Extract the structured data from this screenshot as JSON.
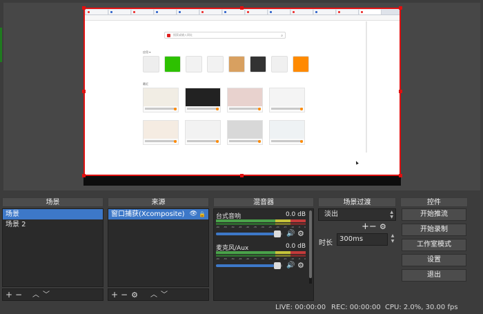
{
  "preview": {
    "browser": {
      "tab_labels": [
        "",
        "",
        "",
        "",
        "",
        "",
        "",
        "",
        "",
        "",
        "",
        "",
        ""
      ],
      "search_placeholder": "搜索或输入网址",
      "apps_section_label": "应用 ▾",
      "recent_section_label": "最近",
      "app_tiles": [
        {
          "caption": "",
          "color": "#eeeeee"
        },
        {
          "caption": "",
          "color": "#2dc100"
        },
        {
          "caption": "",
          "color": "#f2f2f2"
        },
        {
          "caption": "",
          "color": "#f2f2f2"
        },
        {
          "caption": "",
          "color": "#d8a060"
        },
        {
          "caption": "",
          "color": "#333333"
        },
        {
          "caption": "",
          "color": "#f0f0f0"
        },
        {
          "caption": "",
          "color": "#ff8a00"
        }
      ]
    }
  },
  "scenes": {
    "title": "场景",
    "items": [
      "场景",
      "场景 2"
    ],
    "selected": 0
  },
  "sources": {
    "title": "来源",
    "items": [
      "窗口捕获(Xcomposite)"
    ],
    "selected": 0
  },
  "mixer": {
    "title": "混音器",
    "tracks": [
      {
        "name": "台式音响",
        "db": "0.0 dB",
        "volume": 0.88
      },
      {
        "name": "麦克风/Aux",
        "db": "0.0 dB",
        "volume": 0.88
      }
    ],
    "ticks": [
      "-60",
      "-55",
      "-50",
      "-45",
      "-40",
      "-35",
      "-30",
      "-25",
      "-20",
      "-15",
      "-10",
      "-5",
      "0"
    ]
  },
  "transitions": {
    "title": "场景过渡",
    "selected": "淡出",
    "duration_label": "时长",
    "duration_value": "300ms"
  },
  "controls": {
    "title": "控件",
    "buttons": [
      "开始推流",
      "开始录制",
      "工作室模式",
      "设置",
      "退出"
    ]
  },
  "status": {
    "live": "LIVE: 00:00:00",
    "rec": "REC: 00:00:00",
    "cpu": "CPU: 2.0%, 30.00 fps"
  },
  "colors": {
    "selection": "#3d78c8",
    "capture_border": "#e01010",
    "background": "#3c3c3c"
  }
}
